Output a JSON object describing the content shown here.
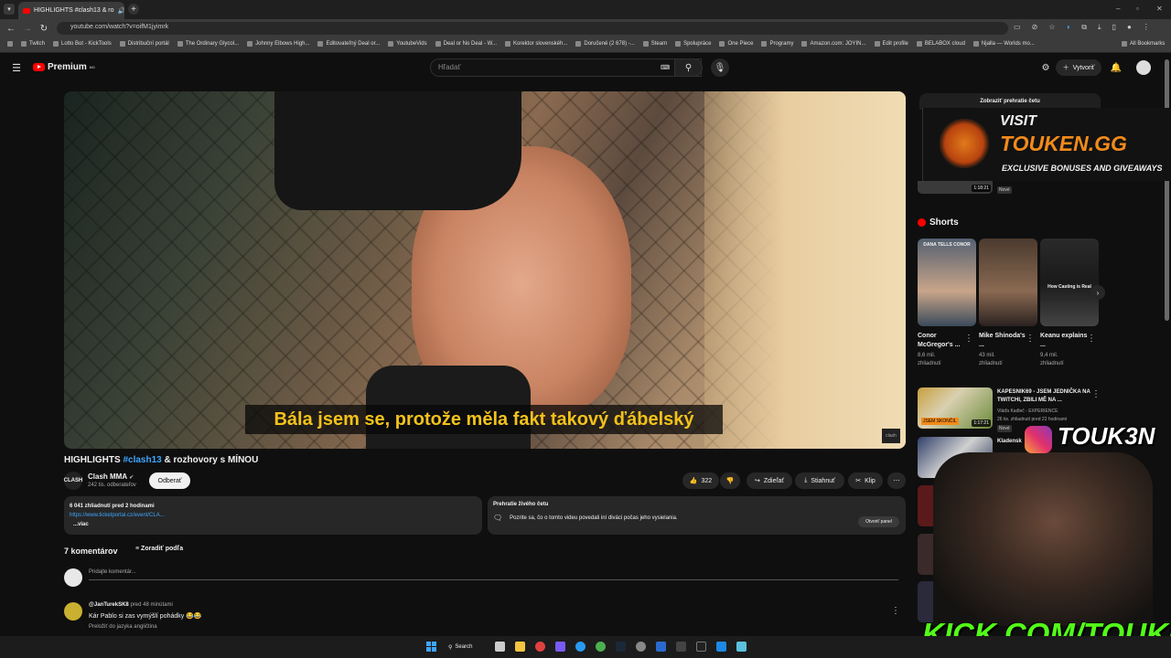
{
  "browser": {
    "tab_title": "HIGHLIGHTS #clash13 & ro",
    "url": "youtube.com/watch?v=oifM1jyimrk",
    "bookmarks": [
      "Twitch",
      "Lotto Bot - KickTools",
      "Distribuční portál",
      "The Ordinary Glycol...",
      "Johnny Elbows High...",
      "Editovateľný Deal or...",
      "YoutubeVids",
      "Deal or No Deal - W...",
      "Korektor slovenskéh...",
      "Doručené (2 678) -...",
      "Steam",
      "Spolupráce",
      "One Piece",
      "Programy",
      "Amazon.com: JOYIN...",
      "Edit profile",
      "BELABOX cloud",
      "Njalla — Worlds mo..."
    ],
    "all_bookmarks": "All Bookmarks"
  },
  "youtube": {
    "logo": "Premium",
    "logo_sup": "NO",
    "search_placeholder": "Hľadať",
    "create_label": "Vytvoriť"
  },
  "video": {
    "subtitle": "Bála jsem se, protože měla fakt takový ďábelský",
    "corner_logo": "clash",
    "title_prefix": "HIGHLIGHTS ",
    "title_hashtag": "#clash13",
    "title_suffix": " & rozhovory s MÍNOU",
    "channel_name": "Clash MMA",
    "channel_avatar": "CLASH",
    "subscribers": "242 tis. odberateľov",
    "subscribe_label": "Odberať",
    "likes": "322",
    "share_label": "Zdieľať",
    "download_label": "Stiahnuť",
    "clip_label": "Klip",
    "views_line": "6 041 zhliadnutí  pred 2 hodinami",
    "desc_link": "https://www.ticketportal.cz/event/CLA...",
    "desc_more": "...viac"
  },
  "live_chat_replay": {
    "title": "Prehratie živého četu",
    "text": "Pozrite sa, čo o tomto videu povedali iní diváci počas jeho vysielania.",
    "button": "Otvoriť panel"
  },
  "comments": {
    "count_label": "7 komentárov",
    "sort_label": "Zoradiť podľa",
    "add_placeholder": "Pridajte komentár...",
    "items": [
      {
        "user": "@JanTurekSK8",
        "time": "pred 48 minútami",
        "text": "Kár Pablo si zas vymýšlí pohádky 😂😂",
        "translate": "Preložiť do jazyka angličtina"
      }
    ]
  },
  "sidebar": {
    "chat_header": "Zobraziť prehratie četu",
    "new_badge": "Nové",
    "first_duration": "1:18:21",
    "shorts_title": "Shorts",
    "shorts": [
      {
        "title": "Conor McGregor's ...",
        "views": "8,6 mil.",
        "views_suffix": "zhliadnutí",
        "thumb_text": "DANA TELLS CONOR"
      },
      {
        "title": "Mike Shinoda's ...",
        "views": "43 mil.",
        "views_suffix": "zhliadnutí",
        "thumb_text": ""
      },
      {
        "title": "Keanu explains ...",
        "views": "9,4 mil.",
        "views_suffix": "zhliadnutí",
        "thumb_text": "How Casting is Real"
      }
    ],
    "related": [
      {
        "title": "KAPESNIK69 - JSEM JEDNIČKA NA TWITCHI, ZBILI MĚ NA ...",
        "channel": "Vláďa Kadleč - EXPERIENCE",
        "meta": "26 tis. zhliadnutí  pred 22 hodinami",
        "badge": "Nové",
        "duration": "1:17:21",
        "thumb_text": "JSEM SKONČIL"
      },
      {
        "title": "Kladensk",
        "channel": "",
        "meta": "",
        "badge": "",
        "duration": "",
        "thumb_text": ""
      }
    ]
  },
  "overlays": {
    "ad_line1": "VISIT",
    "ad_line2": "TOUKEN.GG",
    "ad_line3": "EXCLUSIVE BONUSES AND GIVEAWAYS",
    "instagram": "TOUK3N",
    "kick": "KICK.COM/TOUKEN"
  },
  "taskbar": {
    "search_label": "Search"
  },
  "colors": {
    "background": "#0f0f0f",
    "youtube_red": "#ff0000",
    "subtitle_yellow": "#f2c21b",
    "kick_green": "#53fc18",
    "touken_orange": "#f28a1a",
    "link_blue": "#3ea6ff"
  }
}
